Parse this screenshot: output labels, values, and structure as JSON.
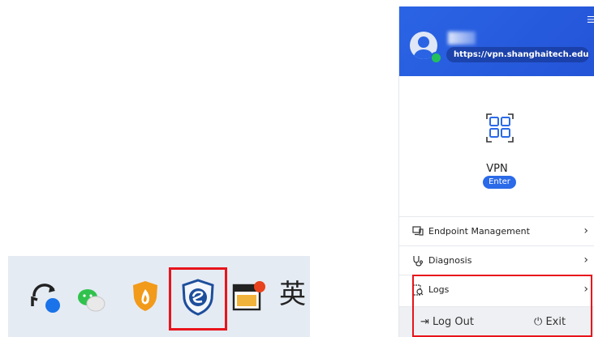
{
  "taskbar": {
    "icons": [
      {
        "name": "sync-icon",
        "color": "#1a73e8"
      },
      {
        "name": "wechat-icon",
        "color": "#31c24d"
      },
      {
        "name": "shield-fire-icon",
        "color": "#f29a1a"
      },
      {
        "name": "vpn-client-icon",
        "color": "#1d4e9c"
      },
      {
        "name": "notepad-window-icon",
        "color": "#f2b33d"
      }
    ],
    "ime_indicator": "英",
    "highlight_color": "#e8141c"
  },
  "panel": {
    "header": {
      "server_url": "https://vpn.shanghaitech.edu...",
      "menu_icon": "list-icon",
      "brand_color": "#2a64e4",
      "status_color": "#22c05c"
    },
    "vpn": {
      "label": "VPN",
      "enter_label": "Enter"
    },
    "menu": [
      {
        "label": "Endpoint Management",
        "icon": "monitor-icon"
      },
      {
        "label": "Diagnosis",
        "icon": "stethoscope-icon"
      },
      {
        "label": "Logs",
        "icon": "logs-icon"
      }
    ],
    "footer": {
      "logout_label": "Log Out",
      "exit_label": "Exit"
    }
  }
}
